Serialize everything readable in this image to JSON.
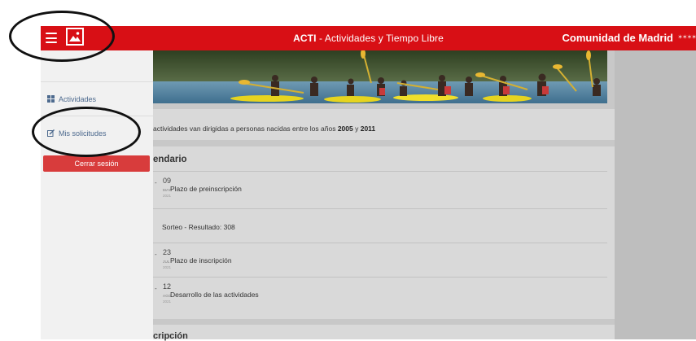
{
  "header": {
    "title_bold": "ACTI",
    "title_rest": " - Actividades y Tiempo Libre",
    "brand": "Comunidad de Madrid",
    "stars": "✶✶✶✶"
  },
  "sidebar": {
    "items": [
      {
        "label": "Actividades",
        "icon": "grid-icon"
      },
      {
        "label": "Mis solicitudes",
        "icon": "edit-icon"
      }
    ],
    "logout_label": "Cerrar sesión"
  },
  "intro": {
    "text": "actividades van dirigidas a personas nacidas entre los años ",
    "year_from": "2005",
    "joiner": " y ",
    "year_to": "2011"
  },
  "calendar": {
    "title": "endario",
    "events": [
      {
        "dash": "-",
        "day": "09",
        "month": "MAY",
        "year": "2021",
        "label": "Plazo de preinscripción"
      },
      {
        "dash": "",
        "day": "",
        "month": "",
        "year": "",
        "label": "Sorteo - Resultado: 308"
      },
      {
        "dash": "-",
        "day": "23",
        "month": "JUL",
        "year": "2021",
        "label": "Plazo de inscripción"
      },
      {
        "dash": "-",
        "day": "12",
        "month": "AGO",
        "year": "2021",
        "label": "Desarrollo de las actividades"
      }
    ]
  },
  "bottom_section": {
    "title": "cripción"
  },
  "colors": {
    "brand_red": "#d80f15",
    "logout_red": "#d83c3c"
  }
}
